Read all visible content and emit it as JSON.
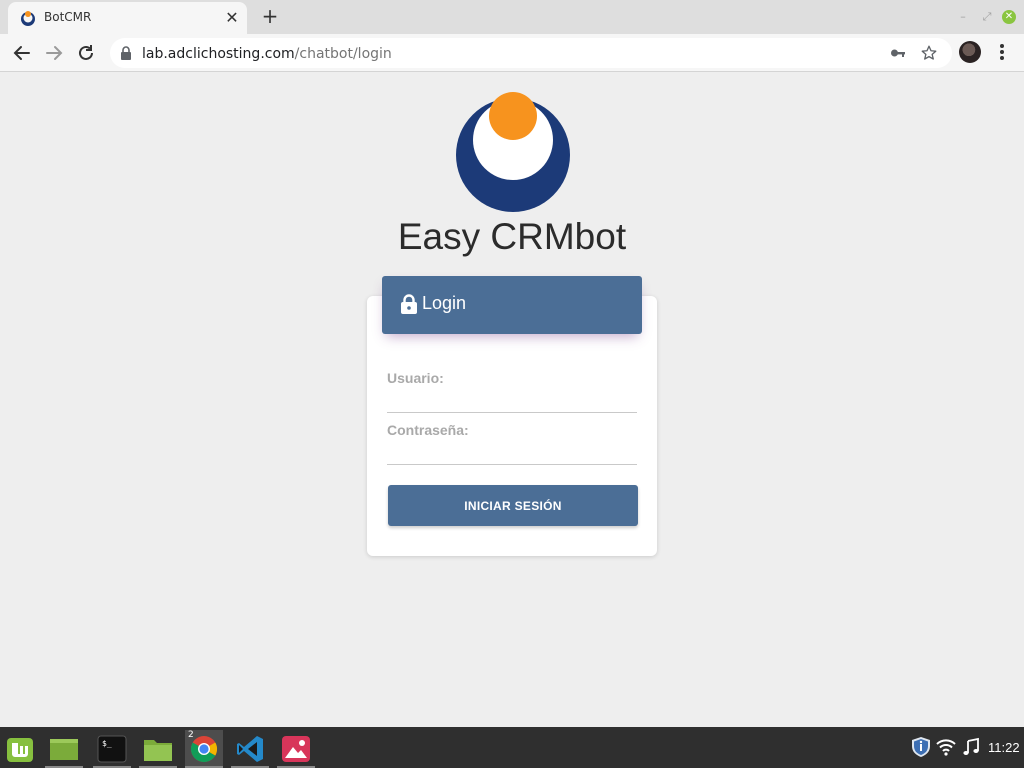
{
  "browser": {
    "tab_title": "BotCMR",
    "url_host": "lab.adclichosting.com",
    "url_path": "/chatbot/login",
    "new_tab_label": "+",
    "close_tab_label": "✕"
  },
  "page": {
    "app_title": "Easy CRMbot",
    "login_header": "Login",
    "username_label": "Usuario:",
    "username_value": "",
    "password_label": "Contraseña:",
    "password_value": "",
    "submit_label": "INICIAR SESIÓN",
    "colors": {
      "primary": "#4b6e96",
      "logo_navy": "#1c3a78",
      "logo_orange": "#f7931e",
      "background": "#eeeeee"
    }
  },
  "taskbar": {
    "chrome_window_count": "2",
    "clock": "11:22",
    "icons": [
      "mint-menu-icon",
      "show-desktop-icon",
      "terminal-icon",
      "files-icon",
      "chrome-icon",
      "vscode-icon",
      "image-viewer-icon"
    ]
  }
}
